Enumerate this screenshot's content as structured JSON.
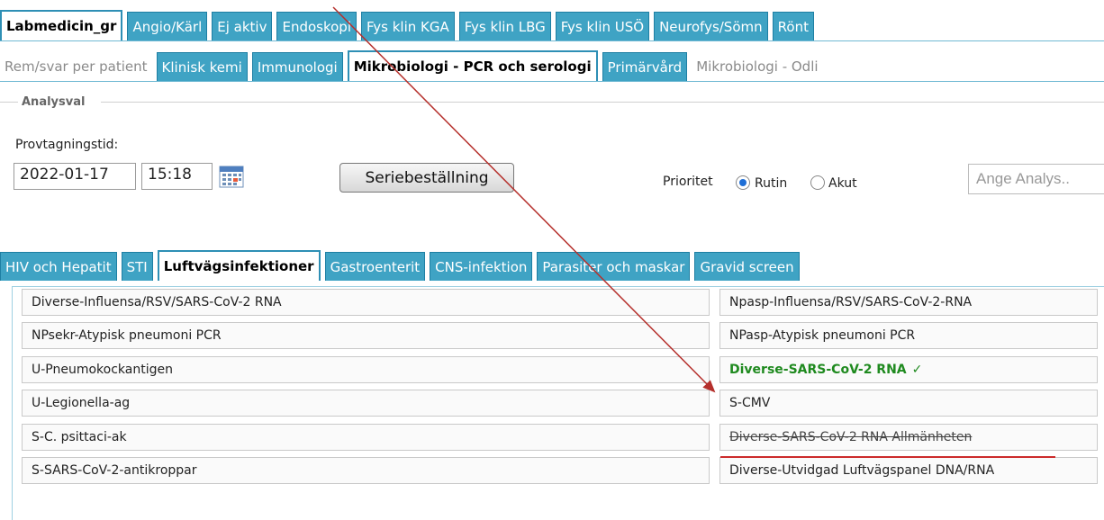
{
  "top_tabs": [
    {
      "label": "Labmedicin_gr",
      "state": "active"
    },
    {
      "label": "Angio/Kärl",
      "state": "normal"
    },
    {
      "label": "Ej aktiv",
      "state": "normal"
    },
    {
      "label": "Endoskopi",
      "state": "normal"
    },
    {
      "label": "Fys klin KGA",
      "state": "normal"
    },
    {
      "label": "Fys klin LBG",
      "state": "normal"
    },
    {
      "label": "Fys klin USÖ",
      "state": "normal"
    },
    {
      "label": "Neurofys/Sömn",
      "state": "normal"
    },
    {
      "label": "Rönt",
      "state": "normal"
    }
  ],
  "sub_tabs": [
    {
      "label": "Rem/svar per patient",
      "state": "disabled"
    },
    {
      "label": "Klinisk kemi",
      "state": "normal"
    },
    {
      "label": "Immunologi",
      "state": "normal"
    },
    {
      "label": "Mikrobiologi - PCR och serologi",
      "state": "active"
    },
    {
      "label": "Primärvård",
      "state": "normal"
    },
    {
      "label": "Mikrobiologi - Odli",
      "state": "disabled"
    }
  ],
  "analysval": {
    "legend": "Analysval",
    "provtagningstid_label": "Provtagningstid:",
    "date": "2022-01-17",
    "time": "15:18",
    "calendar_icon": "calendar-icon",
    "series_button": "Seriebeställning",
    "priority_label": "Prioritet",
    "priority_options": [
      {
        "label": "Rutin",
        "selected": true
      },
      {
        "label": "Akut",
        "selected": false
      }
    ],
    "search_placeholder": "Ange Analys.."
  },
  "category_tabs": [
    {
      "label": "HIV och Hepatit",
      "state": "normal"
    },
    {
      "label": "STI",
      "state": "normal"
    },
    {
      "label": "Luftvägsinfektioner",
      "state": "active"
    },
    {
      "label": "Gastroenterit",
      "state": "normal"
    },
    {
      "label": "CNS-infektion",
      "state": "normal"
    },
    {
      "label": "Parasiter och maskar",
      "state": "normal"
    },
    {
      "label": "Gravid screen",
      "state": "normal"
    }
  ],
  "analyses_left": [
    "Diverse-Influensa/RSV/SARS-CoV-2 RNA",
    "NPsekr-Atypisk pneumoni PCR",
    "U-Pneumokockantigen",
    "U-Legionella-ag",
    "S-C. psittaci-ak",
    "S-SARS-CoV-2-antikroppar"
  ],
  "analyses_right": [
    {
      "label": "Npasp-Influensa/RSV/SARS-CoV-2-RNA",
      "state": "normal"
    },
    {
      "label": "NPasp-Atypisk pneumoni PCR",
      "state": "normal"
    },
    {
      "label": "Diverse-SARS-CoV-2 RNA",
      "state": "selected",
      "check": "✓"
    },
    {
      "label": "S-CMV",
      "state": "normal"
    },
    {
      "label": "Diverse-SARS-CoV-2 RNA Allmänheten",
      "state": "struck"
    },
    {
      "label": "Diverse-Utvidgad Luftvägspanel DNA/RNA",
      "state": "normal"
    }
  ],
  "colors": {
    "tab": "#3fa3c4",
    "selected_text": "#1f8a1f",
    "annotation": "#cc2a2a"
  }
}
